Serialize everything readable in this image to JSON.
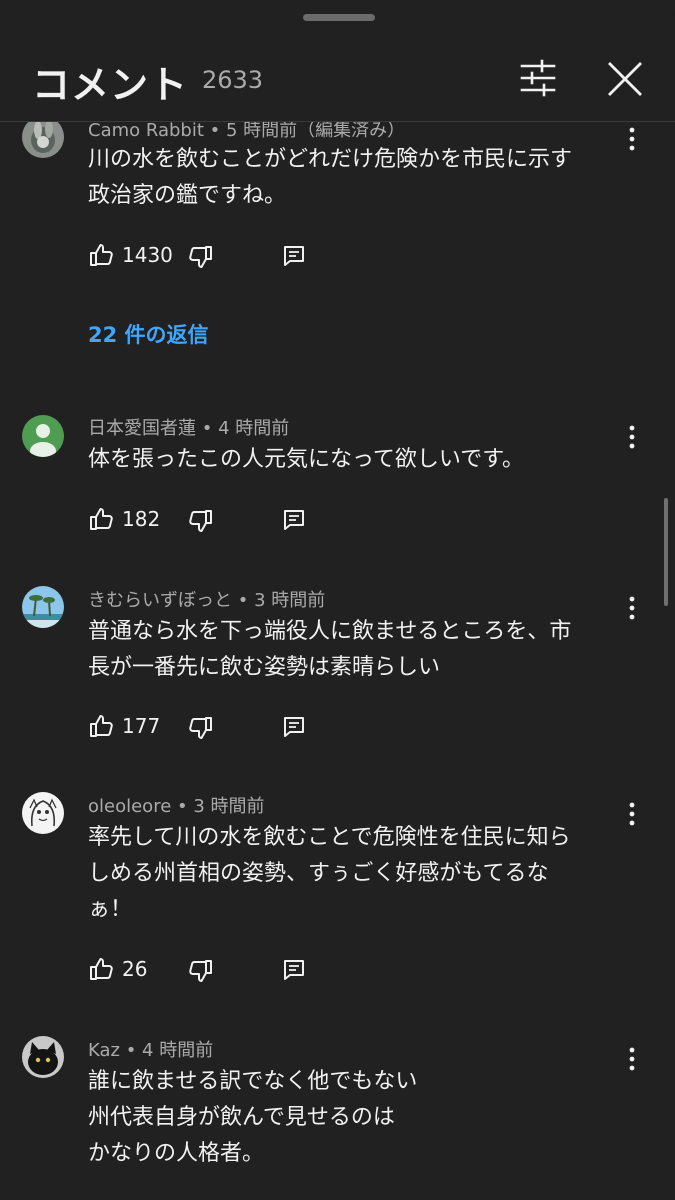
{
  "header": {
    "title": "コメント",
    "count": "2633"
  },
  "comments": [
    {
      "author": "Camo Rabbit",
      "time": "5 時間前（編集済み）",
      "lines": [
        "川の水を飲むことがどれだけ危険かを市民に示す",
        "政治家の鑑ですね。"
      ],
      "likes": "1430",
      "replies_label": "22 件の返信"
    },
    {
      "author": "日本愛国者蓮",
      "time": "4 時間前",
      "lines": [
        "体を張ったこの人元気になって欲しいです。"
      ],
      "likes": "182"
    },
    {
      "author": "きむらいずぼっと",
      "time": "3 時間前",
      "lines": [
        "普通なら水を下っ端役人に飲ませるところを、市",
        "長が一番先に飲む姿勢は素晴らしい"
      ],
      "likes": "177"
    },
    {
      "author": "oleoleore",
      "time": "3 時間前",
      "lines": [
        "率先して川の水を飲むことで危険性を住民に知ら",
        "しめる州首相の姿勢、すぅごく好感がもてるな",
        "ぁ！"
      ],
      "likes": "26"
    },
    {
      "author": "Kaz",
      "time": "4 時間前",
      "lines": [
        "誰に飲ませる訳でなく他でもない",
        "州代表自身が飲んで見せるのは",
        "かなりの人格者。"
      ]
    }
  ],
  "separator": " • ",
  "icons": {
    "filter": "filter-icon",
    "close": "close-icon",
    "more": "more-vert-icon",
    "like": "thumb-up-icon",
    "dislike": "thumb-down-icon",
    "reply": "reply-icon"
  },
  "colors": {
    "background": "#212121",
    "accent": "#3ea6ff",
    "secondary_text": "#aaaaaa"
  }
}
